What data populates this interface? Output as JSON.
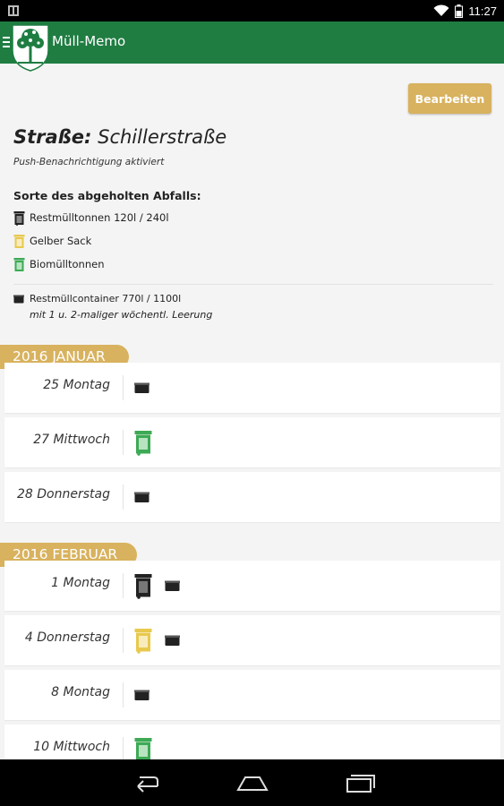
{
  "status_bar": {
    "time": "11:27"
  },
  "app_bar": {
    "title": "Müll-Memo",
    "logo_icon": "coat-of-arms-tree-logo",
    "menu_icon": "hamburger-icon"
  },
  "edit_button": {
    "label": "Bearbeiten"
  },
  "street": {
    "label": "Straße:",
    "name": "Schillerstraße"
  },
  "push_note": "Push-Benachrichtigung aktiviert",
  "waste_types": {
    "heading": "Sorte des abgeholten Abfalls:",
    "items": [
      {
        "label": "Restmülltonnen 120l / 240l",
        "icon": "black-bin-icon",
        "color": "#222222"
      },
      {
        "label": "Gelber Sack",
        "icon": "yellow-bin-icon",
        "color": "#e8c94e"
      },
      {
        "label": "Biomülltonnen",
        "icon": "green-bin-icon",
        "color": "#3daa55"
      }
    ]
  },
  "container_note": {
    "line1": "Restmüllcontainer 770l / 1100l",
    "line2": "mit 1 u. 2-maliger wöchentl. Leerung",
    "icon": "container-icon"
  },
  "months": [
    {
      "title": "2016 JANUAR",
      "days": [
        {
          "label": "25 Montag",
          "icons": [
            "container"
          ]
        },
        {
          "label": "27 Mittwoch",
          "icons": [
            "green-bin"
          ]
        },
        {
          "label": "28 Donnerstag",
          "icons": [
            "container"
          ]
        }
      ]
    },
    {
      "title": "2016 FEBRUAR",
      "days": [
        {
          "label": "1 Montag",
          "icons": [
            "black-bin",
            "container"
          ]
        },
        {
          "label": "4 Donnerstag",
          "icons": [
            "yellow-bin",
            "container"
          ]
        },
        {
          "label": "8 Montag",
          "icons": [
            "container"
          ]
        },
        {
          "label": "10 Mittwoch",
          "icons": [
            "green-bin"
          ]
        }
      ]
    }
  ],
  "colors": {
    "app_bar": "#1f7d42",
    "accent_gold": "#d8b25f",
    "background": "#f4f4f4"
  }
}
